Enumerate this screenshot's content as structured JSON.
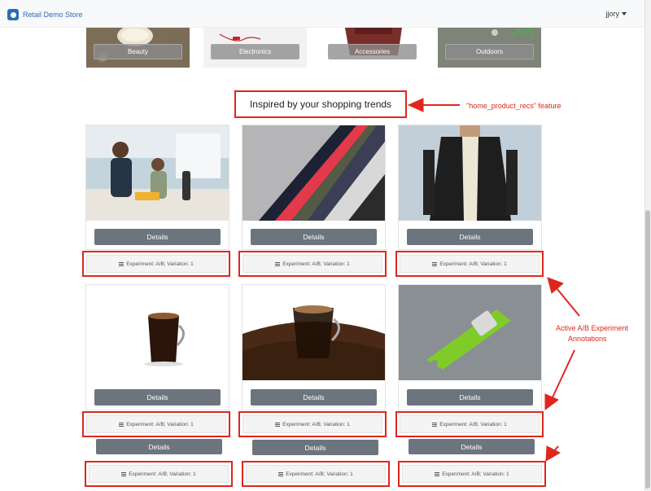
{
  "navbar": {
    "brand": "Retail Demo Store",
    "user": "jjory"
  },
  "categories": [
    {
      "label": "Beauty"
    },
    {
      "label": "Electronics"
    },
    {
      "label": "Accessories"
    },
    {
      "label": "Outdoors"
    }
  ],
  "section": {
    "heading": "Inspired by your shopping trends"
  },
  "callouts": {
    "feature": "\"home_product_recs\" feature",
    "ab_line1": "Active A/B Experiment",
    "ab_line2": "Annotations"
  },
  "products": [
    {
      "image": "kitchen-blender-photo",
      "details": "Details",
      "experiment": "Experiment: A/B; Variation: 1"
    },
    {
      "image": "folded-fabric-photo",
      "details": "Details",
      "experiment": "Experiment: A/B; Variation: 1"
    },
    {
      "image": "bomber-jacket-photo",
      "details": "Details",
      "experiment": "Experiment: A/B; Variation: 1"
    },
    {
      "image": "coffee-mug-photo",
      "details": "Details",
      "experiment": "Experiment: A/B; Variation: 1"
    },
    {
      "image": "coffee-beans-mug-photo",
      "details": "Details",
      "experiment": "Experiment: A/B; Variation: 1"
    },
    {
      "image": "garlic-grater-photo",
      "details": "Details",
      "experiment": "Experiment: A/B; Variation: 1"
    },
    {
      "details": "Details",
      "experiment": "Experiment: A/B; Variation: 1"
    },
    {
      "details": "Details",
      "experiment": "Experiment: A/B; Variation: 1"
    },
    {
      "details": "Details",
      "experiment": "Experiment: A/B; Variation: 1"
    }
  ],
  "colors": {
    "brand": "#2d6bb5",
    "annotation": "#e0261c",
    "button": "#6c757d"
  }
}
